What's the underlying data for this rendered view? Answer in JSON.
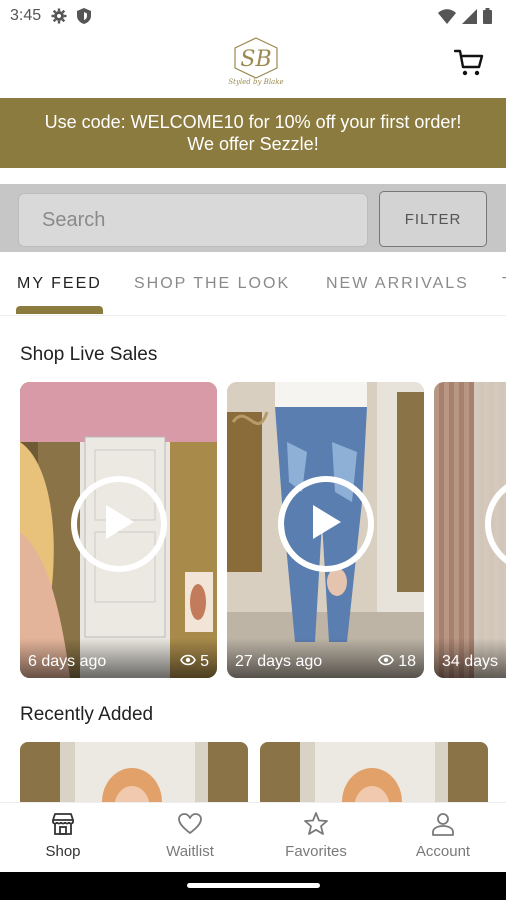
{
  "status_bar": {
    "time": "3:45",
    "icons": [
      "settings-gear-icon",
      "shield-icon",
      "wifi-icon",
      "signal-icon",
      "battery-icon"
    ]
  },
  "header": {
    "logo_text": "Styled by Blake",
    "logo_monogram": "SB",
    "cart_icon": "cart-icon"
  },
  "promo": {
    "text": "Use code: WELCOME10 for 10% off your first order! We offer Sezzle!"
  },
  "search": {
    "placeholder": "Search",
    "filter_label": "FILTER"
  },
  "tabs": [
    {
      "label": "MY FEED",
      "active": true
    },
    {
      "label": "SHOP THE LOOK",
      "active": false
    },
    {
      "label": "NEW ARRIVALS",
      "active": false
    }
  ],
  "live_sales": {
    "title": "Shop Live Sales",
    "cards": [
      {
        "age": "6 days ago",
        "views": "5"
      },
      {
        "age": "27 days ago",
        "views": "18"
      },
      {
        "age": "34 days",
        "views": ""
      }
    ]
  },
  "recently_added": {
    "title": "Recently Added"
  },
  "bottom_nav": [
    {
      "label": "Shop",
      "icon": "shop-icon",
      "active": true
    },
    {
      "label": "Waitlist",
      "icon": "heart-icon",
      "active": false
    },
    {
      "label": "Favorites",
      "icon": "star-icon",
      "active": false
    },
    {
      "label": "Account",
      "icon": "person-icon",
      "active": false
    }
  ],
  "colors": {
    "brand_gold": "#8c7b3f",
    "search_bg": "#c6c6c6"
  }
}
